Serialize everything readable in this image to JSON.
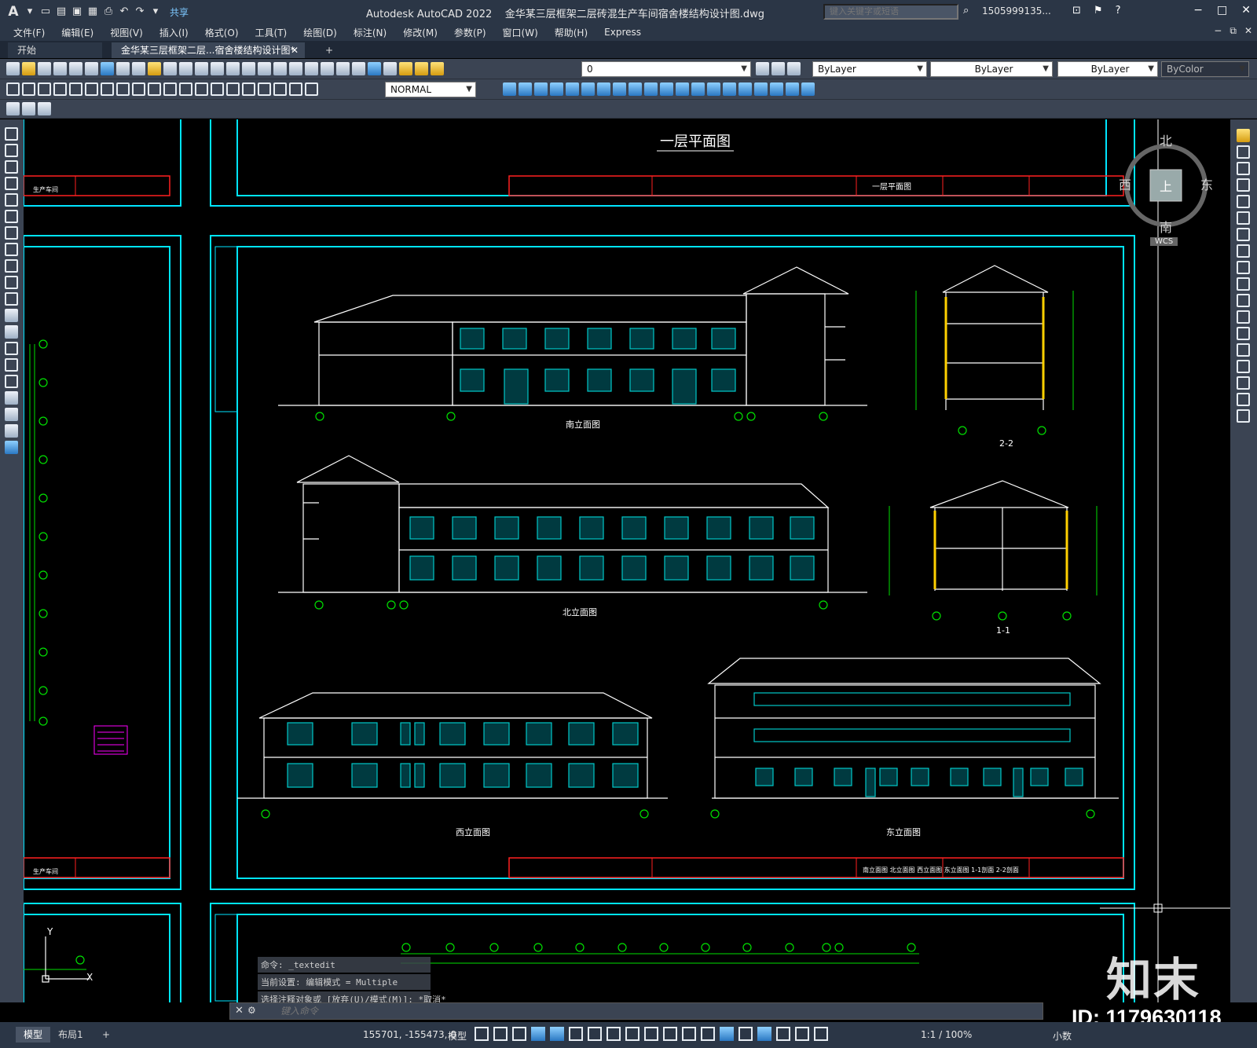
{
  "titlebar": {
    "app": "Autodesk AutoCAD 2022",
    "file": "金华某三层框架二层砖混生产车间宿舍楼结构设计图.dwg",
    "share": "共享",
    "search_placeholder": "键入关键字或短语",
    "user": "1505999135...",
    "window_controls": [
      "−",
      "□",
      "✕"
    ]
  },
  "menu": {
    "items": [
      "文件(F)",
      "编辑(E)",
      "视图(V)",
      "插入(I)",
      "格式(O)",
      "工具(T)",
      "绘图(D)",
      "标注(N)",
      "修改(M)",
      "参数(P)",
      "窗口(W)",
      "帮助(H)",
      "Express"
    ]
  },
  "tabs": {
    "start": "开始",
    "doc": "金华某三层框架二层...宿舍楼结构设计图*",
    "close": "✕",
    "add": "+"
  },
  "toolbar": {
    "layer": "0",
    "color": "ByLayer",
    "linetype": "ByLayer",
    "lineweight": "ByLayer",
    "plotstyle": "ByColor",
    "style": "NORMAL"
  },
  "viewcube": {
    "north": "北",
    "south": "南",
    "east": "东",
    "west": "西",
    "top": "上",
    "wcs": "WCS"
  },
  "drawing": {
    "sheet_title": "一层平面图",
    "south_elev": "南立面图",
    "north_elev": "北立面图",
    "west_elev": "西立面图",
    "east_elev": "东立面图",
    "sec22": "2-2",
    "sec11": "1-1",
    "tb_top_name": "一层平面图",
    "tb_bottom_names": "南立面图 北立面图 西立面图 东立面图 1-1剖面 2-2剖面",
    "left_tb_top": "生产车间",
    "left_tb_bottom": "生产车间"
  },
  "command": {
    "history": [
      "命令: _textedit",
      "当前设置: 编辑模式 = Multiple",
      "选择注释对象或 [放弃(U)/模式(M)]: *取消*"
    ],
    "placeholder": "键入命令"
  },
  "status": {
    "model_tab": "模型",
    "layout1_tab": "布局1",
    "add": "+",
    "coords": "155701, -155473, 0",
    "model": "模型",
    "scale": "1:1 / 100%",
    "units": "小数"
  },
  "watermark": {
    "brand": "知末",
    "id": "ID: 1179630118"
  }
}
